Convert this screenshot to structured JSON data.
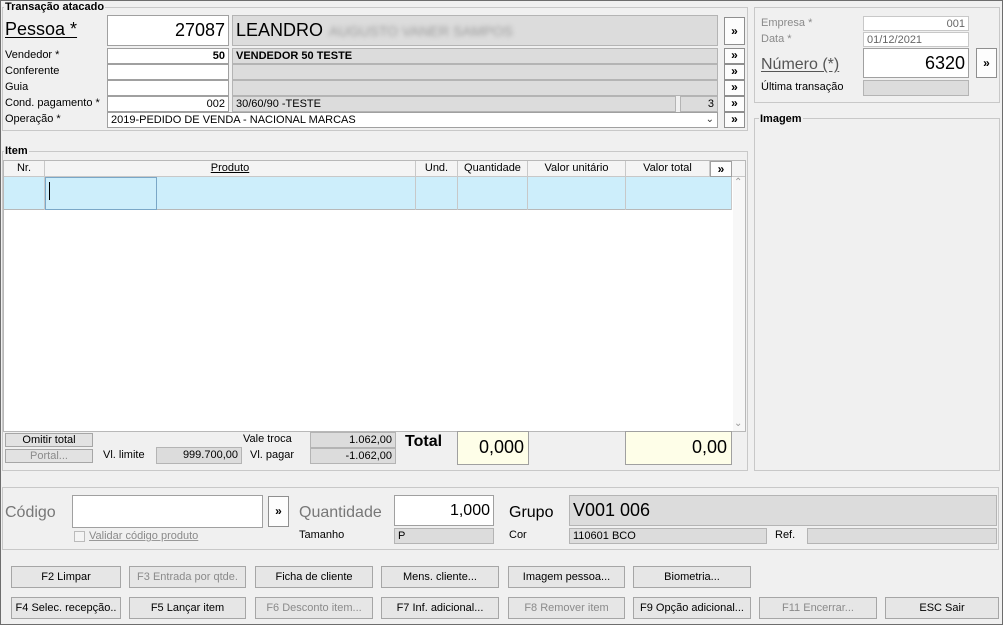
{
  "transaction": {
    "group_title": "Transação atacado",
    "pessoa_label": "Pessoa *",
    "pessoa_code": "27087",
    "pessoa_name": "LEANDRO",
    "pessoa_name_redacted": "AUGUSTO VANER SAMPOS",
    "vendedor_label": "Vendedor *",
    "vendedor_code": "50",
    "vendedor_name": "VENDEDOR 50 TESTE",
    "conferente_label": "Conferente",
    "conferente_code": "",
    "conferente_name": "",
    "guia_label": "Guia",
    "guia_code": "",
    "guia_name": "",
    "cond_label": "Cond. pagamento *",
    "cond_code": "002",
    "cond_name": "30/60/90 -TESTE",
    "cond_count": "3",
    "operacao_label": "Operação *",
    "operacao_value": "2019-PEDIDO DE VENDA - NACIONAL MARCAS",
    "expand_glyph": "»"
  },
  "empresa": {
    "empresa_label": "Empresa *",
    "empresa_value": "001",
    "data_label": "Data *",
    "data_value": "01/12/2021",
    "numero_label": "Número (*)",
    "numero_value": "6320",
    "ultima_label": "Última transação",
    "ultima_value": ""
  },
  "imagem": {
    "title": "Imagem"
  },
  "items": {
    "group_title": "Item",
    "columns": [
      "Nr.",
      "Produto",
      "Und.",
      "Quantidade",
      "Valor unitário",
      "Valor total",
      "»"
    ],
    "rows": [
      {
        "nr": "",
        "codigo": "",
        "produto": "",
        "und": "",
        "quantidade": "",
        "valor_unitario": "",
        "valor_total": ""
      }
    ]
  },
  "totals": {
    "omitir_total": "Omitir total",
    "portal": "Portal...",
    "vl_limite_label": "Vl. limite",
    "vl_limite_value": "999.700,00",
    "vale_troca_label": "Vale troca",
    "vale_troca_value": "1.062,00",
    "vl_pagar_label": "Vl. pagar",
    "vl_pagar_value": "-1.062,00",
    "total_label": "Total",
    "total_qty": "0,000",
    "total_value": "0,00"
  },
  "entry": {
    "codigo_label": "Código",
    "codigo_value": "",
    "validar_label": "Validar código produto",
    "quantidade_label": "Quantidade",
    "quantidade_value": "1,000",
    "tamanho_label": "Tamanho",
    "tamanho_value": "P",
    "grupo_label": "Grupo",
    "grupo_value": "V001 006",
    "cor_label": "Cor",
    "cor_value": "110601 BCO",
    "ref_label": "Ref.",
    "ref_value": ""
  },
  "buttons": {
    "f2": "F2 Limpar",
    "f3": "F3 Entrada por qtde.",
    "ficha": "Ficha de cliente",
    "mens": "Mens. cliente...",
    "imagem_pessoa": "Imagem pessoa...",
    "biometria": "Biometria...",
    "f4": "F4 Selec. recepção..",
    "f5": "F5 Lançar item",
    "f6": "F6 Desconto item...",
    "f7": "F7 Inf. adicional...",
    "f8": "F8 Remover item",
    "f9": "F9 Opção adicional...",
    "f11": "F11 Encerrar...",
    "esc": "ESC Sair"
  }
}
